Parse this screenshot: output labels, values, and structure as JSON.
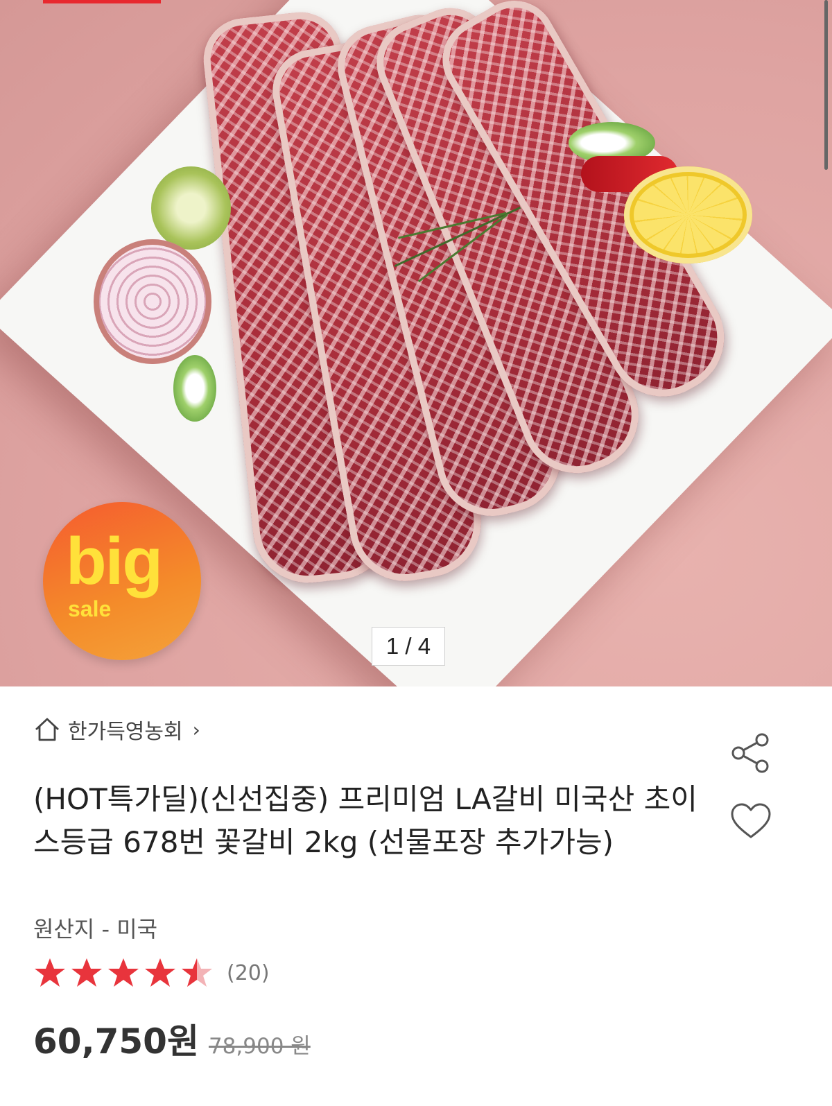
{
  "gallery": {
    "current": 1,
    "total": 4,
    "pager_text": "1 / 4"
  },
  "badge": {
    "big": "big",
    "sale": "sale",
    "colors": {
      "start": "#f55b2f",
      "end": "#f5a23a",
      "text": "#ffe13a"
    }
  },
  "store": {
    "name": "한가득영농회",
    "chevron": "›"
  },
  "product": {
    "title": "(HOT특가딜)(신선집중) 프리미엄 LA갈비 미국산 초이스등급 678번 꽃갈비 2kg (선물포장 추가가능)",
    "origin": "원산지 - 미국",
    "rating": 4.5,
    "review_count_text": "(20)",
    "price": "60,750원",
    "original_price": "78,900 원"
  },
  "colors": {
    "accent": "#e8282e",
    "star": "#e8343c",
    "text": "#222222"
  },
  "icons": {
    "home": "home-icon",
    "share": "share-icon",
    "heart": "heart-icon",
    "star": "star-icon"
  }
}
